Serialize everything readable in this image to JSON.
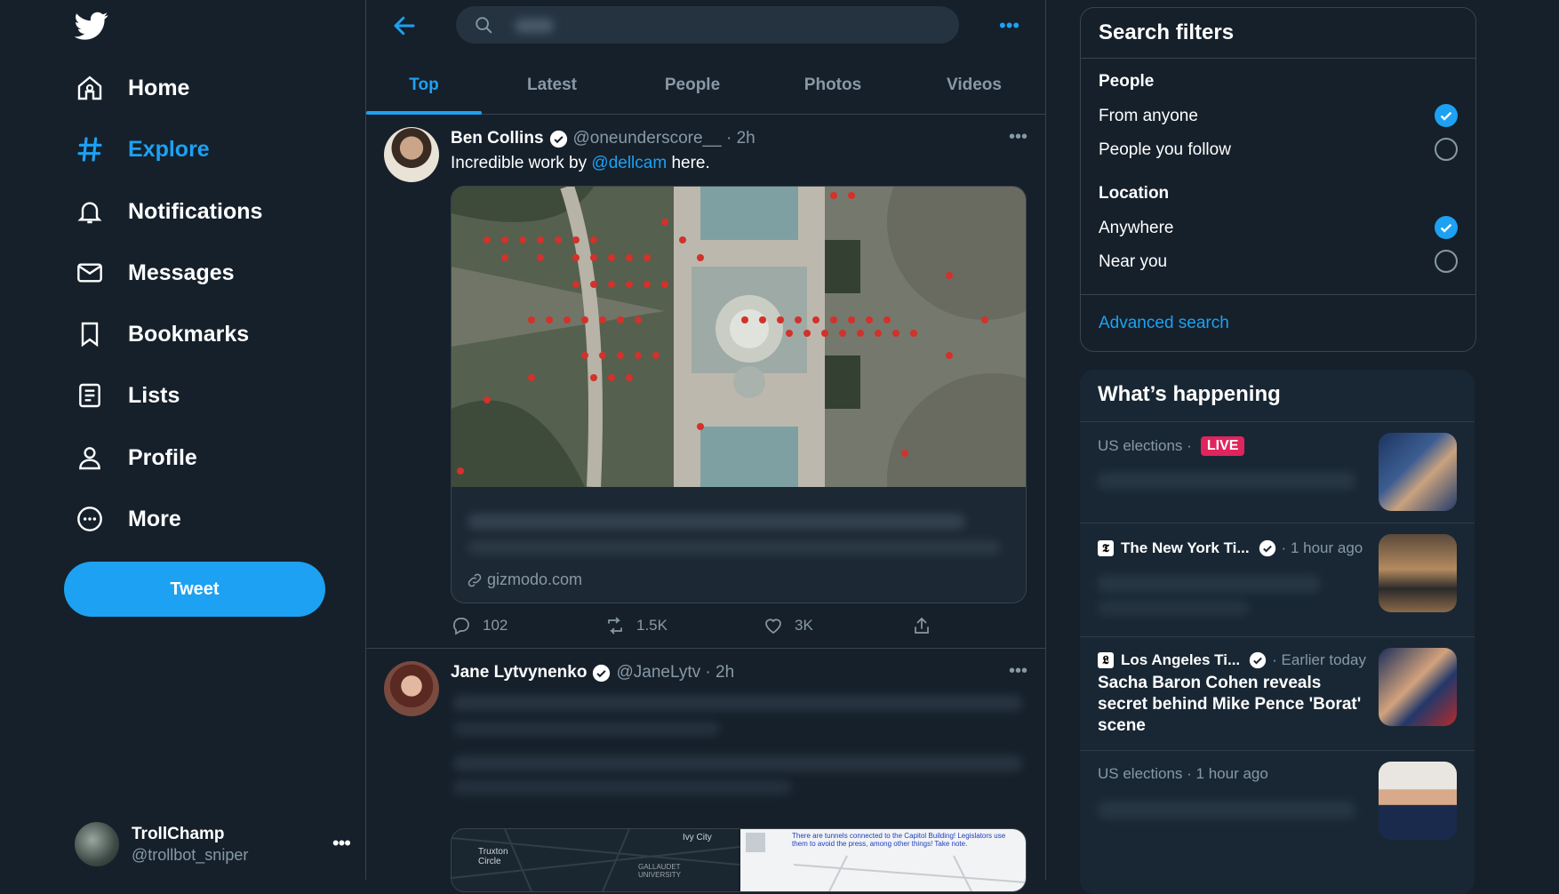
{
  "nav": {
    "items": [
      {
        "label": "Home",
        "icon": "home-icon"
      },
      {
        "label": "Explore",
        "icon": "hashtag-icon",
        "active": true
      },
      {
        "label": "Notifications",
        "icon": "bell-icon"
      },
      {
        "label": "Messages",
        "icon": "envelope-icon"
      },
      {
        "label": "Bookmarks",
        "icon": "bookmark-icon"
      },
      {
        "label": "Lists",
        "icon": "list-icon"
      },
      {
        "label": "Profile",
        "icon": "person-icon"
      },
      {
        "label": "More",
        "icon": "more-circle-icon"
      }
    ],
    "tweet_button": "Tweet"
  },
  "account": {
    "name": "TrollChamp",
    "handle": "@trollbot_sniper"
  },
  "search": {
    "value": "",
    "placeholder": ""
  },
  "tabs": [
    "Top",
    "Latest",
    "People",
    "Photos",
    "Videos"
  ],
  "tweets": [
    {
      "name": "Ben Collins",
      "handle": "@oneunderscore__",
      "time": "2h",
      "text_before": "Incredible work by ",
      "mention": "@dellcam",
      "text_after": " here.",
      "card_domain": "gizmodo.com",
      "replies": "102",
      "retweets": "1.5K",
      "likes": "3K"
    },
    {
      "name": "Jane Lytvynenko",
      "handle": "@JaneLytv",
      "time": "2h",
      "map_labels": [
        "Truxton Circle",
        "Ivy City",
        "GALLAUDET UNIVERSITY"
      ],
      "preview_text": "There are tunnels connected to the Capitol Building! Legislators use them to avoid the press, among other things! Take note."
    }
  ],
  "filters": {
    "title": "Search filters",
    "people_title": "People",
    "people_options": [
      {
        "label": "From anyone",
        "checked": true
      },
      {
        "label": "People you follow",
        "checked": false
      }
    ],
    "location_title": "Location",
    "location_options": [
      {
        "label": "Anywhere",
        "checked": true
      },
      {
        "label": "Near you",
        "checked": false
      }
    ],
    "advanced": "Advanced search"
  },
  "happening": {
    "title": "What’s happening",
    "items": [
      {
        "category": "US elections",
        "badge": "LIVE"
      },
      {
        "source": "The New York Ti...",
        "time": "1 hour ago",
        "logo": "𝕿"
      },
      {
        "source": "Los Angeles Ti...",
        "time": "Earlier today",
        "logo": "𝕷",
        "headline": "Sacha Baron Cohen reveals secret behind Mike Pence 'Borat' scene"
      },
      {
        "category": "US elections",
        "time": "1 hour ago"
      }
    ]
  },
  "colors": {
    "background": "#15202b",
    "accent": "#1da1f2",
    "panel": "#192734",
    "muted": "#8899a6",
    "live": "#e0245e"
  }
}
